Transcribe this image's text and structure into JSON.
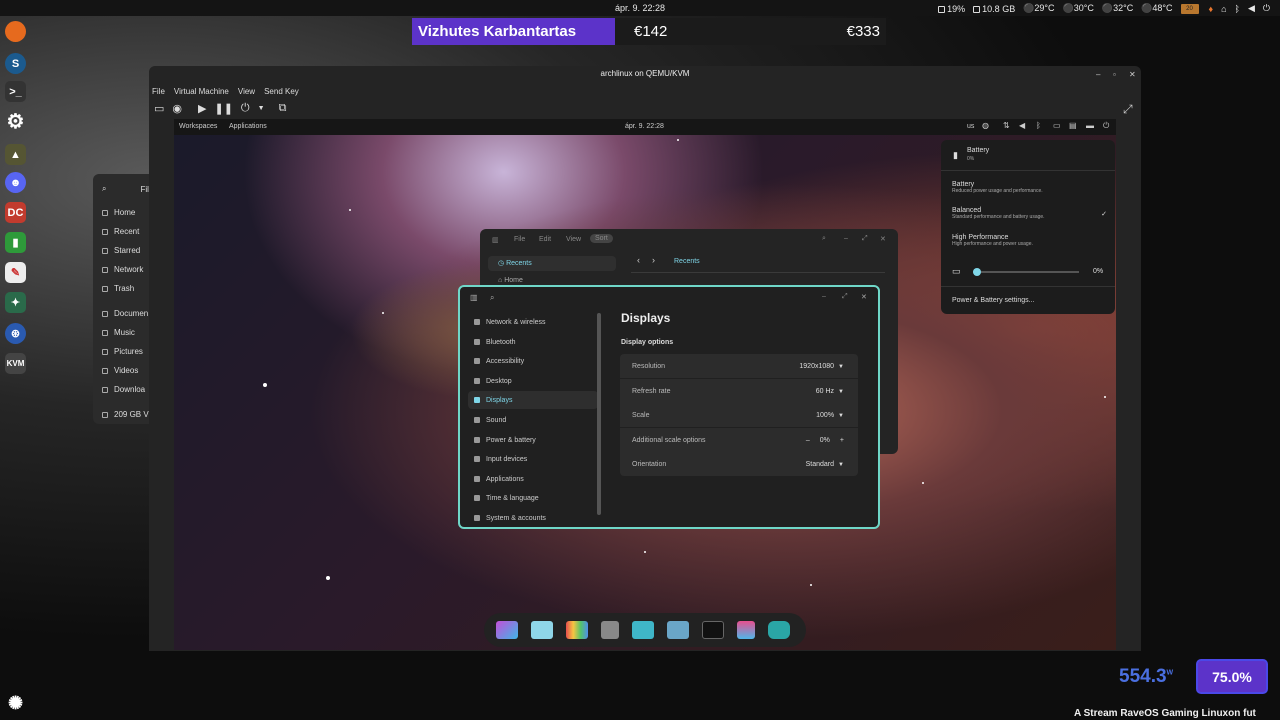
{
  "host": {
    "clock": "ápr. 9. 22:28",
    "stats": [
      {
        "icon": "battery-icon",
        "label": "19%"
      },
      {
        "icon": "memory-icon",
        "label": "10.8 GB"
      },
      {
        "icon": "cpu-temp-icon",
        "label": "29°C"
      },
      {
        "icon": "gpu-temp-icon",
        "label": "30°C"
      },
      {
        "icon": "nvme-temp-icon",
        "label": "32°C"
      },
      {
        "icon": "disk-temp-icon",
        "label": "48°C"
      }
    ],
    "indicator_badge": "20"
  },
  "banner": {
    "name": "Vizhutes Karbantartas",
    "price1": "€142",
    "price2": "€333"
  },
  "dock_icons": [
    "firefox-icon",
    "steam-icon",
    "terminal-icon",
    "settings-gear-icon",
    "app-icon",
    "discord-icon",
    "dc-app-icon",
    "green-app-icon",
    "notes-icon",
    "puzzle-icon",
    "steering-icon",
    "kvm-icon"
  ],
  "bg_file_manager": {
    "search_label": "Fil",
    "items": [
      "Home",
      "Recent",
      "Starred",
      "Network",
      "Trash",
      "Documen",
      "Music",
      "Pictures",
      "Videos",
      "Downloa",
      "209 GB V"
    ]
  },
  "vm": {
    "title": "archlinux on QEMU/KVM",
    "menu": [
      "File",
      "Virtual Machine",
      "View",
      "Send Key"
    ],
    "guest_bar": {
      "left": [
        "Workspaces",
        "Applications"
      ],
      "clock": "ápr. 9. 22:28",
      "keyboard": "us"
    },
    "files": {
      "menu": [
        "File",
        "Edit",
        "View",
        "Sort"
      ],
      "sidebar": [
        "Recents",
        "Home"
      ],
      "location": "Recents"
    },
    "settings": {
      "title": "Displays",
      "section": "Display options",
      "nav": [
        {
          "label": "Network & wireless",
          "icon": "network-icon"
        },
        {
          "label": "Bluetooth",
          "icon": "bluetooth-icon"
        },
        {
          "label": "Accessibility",
          "icon": "accessibility-icon"
        },
        {
          "label": "Desktop",
          "icon": "desktop-icon"
        },
        {
          "label": "Displays",
          "icon": "display-icon"
        },
        {
          "label": "Sound",
          "icon": "sound-icon"
        },
        {
          "label": "Power & battery",
          "icon": "power-icon"
        },
        {
          "label": "Input devices",
          "icon": "input-icon"
        },
        {
          "label": "Applications",
          "icon": "apps-icon"
        },
        {
          "label": "Time & language",
          "icon": "clock-icon"
        },
        {
          "label": "System & accounts",
          "icon": "accounts-icon"
        }
      ],
      "active_nav": "Displays",
      "options": [
        {
          "label": "Resolution",
          "value": "1920x1080"
        },
        {
          "label": "Refresh rate",
          "value": "60 Hz"
        },
        {
          "label": "Scale",
          "value": "100%"
        },
        {
          "label": "Additional scale options",
          "value": "0%"
        },
        {
          "label": "Orientation",
          "value": "Standard"
        }
      ]
    },
    "power_popover": {
      "battery_title": "Battery",
      "battery_sub": "0%",
      "profiles": [
        {
          "name": "Battery",
          "desc": "Reduced power usage and performance."
        },
        {
          "name": "Balanced",
          "desc": "Standard performance and battery usage."
        },
        {
          "name": "High Performance",
          "desc": "High performance and power usage."
        }
      ],
      "selected_profile": "Balanced",
      "brightness": "0%",
      "brightness_level": 0,
      "settings_link": "Power & Battery settings..."
    },
    "guest_dock": [
      "search-icon",
      "multitasking-icon",
      "app-grid-icon",
      "settings-icon",
      "files-icon",
      "editor-icon",
      "terminal-icon",
      "store-icon",
      "screenshot-icon"
    ]
  },
  "overlay": {
    "watt": "554.3",
    "watt_unit": "W",
    "percent": "75.0%",
    "ticker": "A Stream RaveOS Gaming Linuxon fut"
  }
}
